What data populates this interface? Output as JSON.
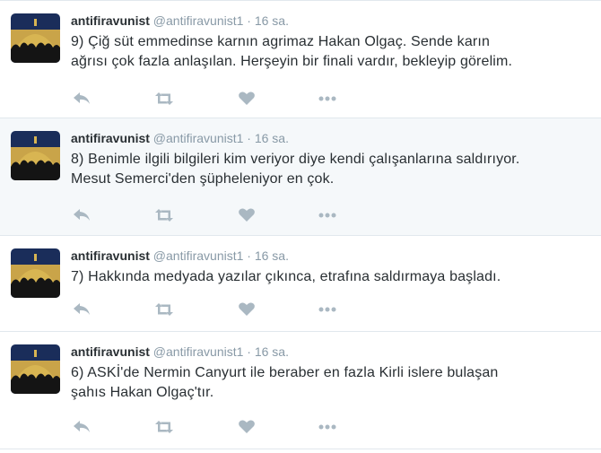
{
  "tweets": [
    {
      "name": "antifiravunist",
      "handle": "@antifiravunist1",
      "separator": "·",
      "time": "16 sa.",
      "lines": [
        "9) Çiğ süt emmedinse karnın agrimaz Hakan Olgaç. Sende karın",
        "ağrısı çok fazla anlaşılan. Herşeyin bir finali vardır, bekleyip görelim."
      ]
    },
    {
      "name": "antifiravunist",
      "handle": "@antifiravunist1",
      "separator": "·",
      "time": "16 sa.",
      "lines": [
        "8) Benimle ilgili bilgileri kim veriyor diye kendi çalışanlarına saldırıyor.",
        "Mesut Semerci'den şüpheleniyor en çok."
      ]
    },
    {
      "name": "antifiravunist",
      "handle": "@antifiravunist1",
      "separator": "·",
      "time": "16 sa.",
      "lines": [
        "7) Hakkında medyada yazılar çıkınca, etrafına saldırmaya başladı."
      ]
    },
    {
      "name": "antifiravunist",
      "handle": "@antifiravunist1",
      "separator": "·",
      "time": "16 sa.",
      "lines": [
        "6) ASKİ'de Nermin Canyurt ile beraber en fazla Kirli islere bulaşan",
        "şahıs Hakan Olgaç'tır."
      ]
    }
  ],
  "colors": {
    "icon": "#aab8c2",
    "name": "#292f33",
    "meta": "#8899a6",
    "highlight_bg": "#f5f8fa",
    "border": "#e1e8ed"
  },
  "icons": [
    "reply-icon",
    "retweet-icon",
    "like-icon",
    "more-icon"
  ]
}
